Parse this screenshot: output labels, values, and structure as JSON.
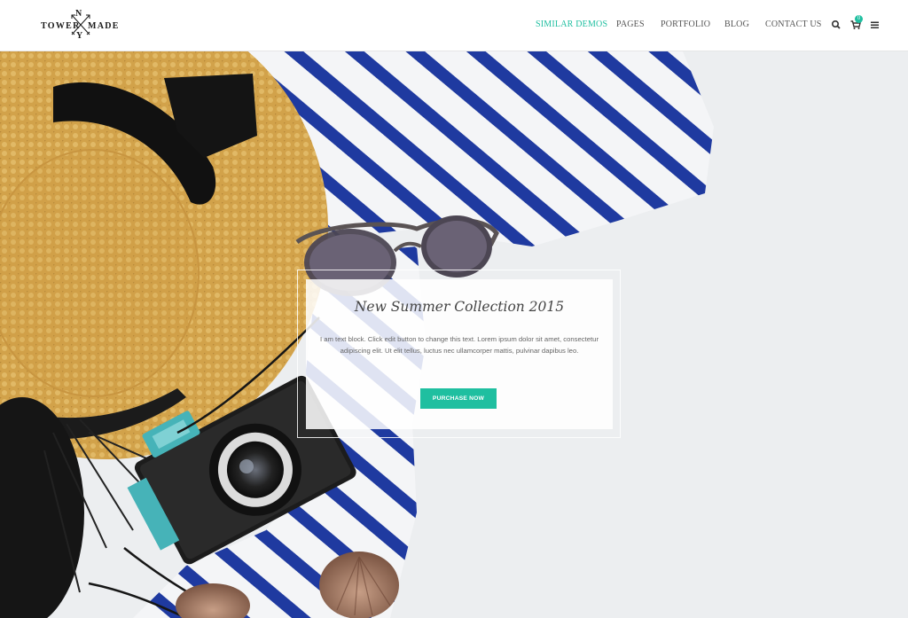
{
  "brand": {
    "left_word": "TOWER",
    "right_word": "MADE",
    "top_letter": "N",
    "bottom_letter": "Y"
  },
  "nav": {
    "items": [
      "SIMILAR DEMOS",
      "PAGES",
      "PORTFOLIO",
      "BLOG",
      "CONTACT US"
    ],
    "active_index": 0,
    "icons": [
      "search-icon",
      "cart-icon",
      "menu-icon"
    ],
    "cart_count": "0"
  },
  "hero": {
    "title": "New Summer Collection 2015",
    "text": "I am text block. Click edit button to change this text. Lorem ipsum dolor sit amet, consectetur adipiscing elit. Ut elit tellus, luctus nec ullamcorper mattis, pulvinar dapibus leo.",
    "button_label": "PURCHASE NOW"
  },
  "colors": {
    "accent": "#1fbfa0",
    "background": "#eceef0",
    "text": "#555555"
  }
}
